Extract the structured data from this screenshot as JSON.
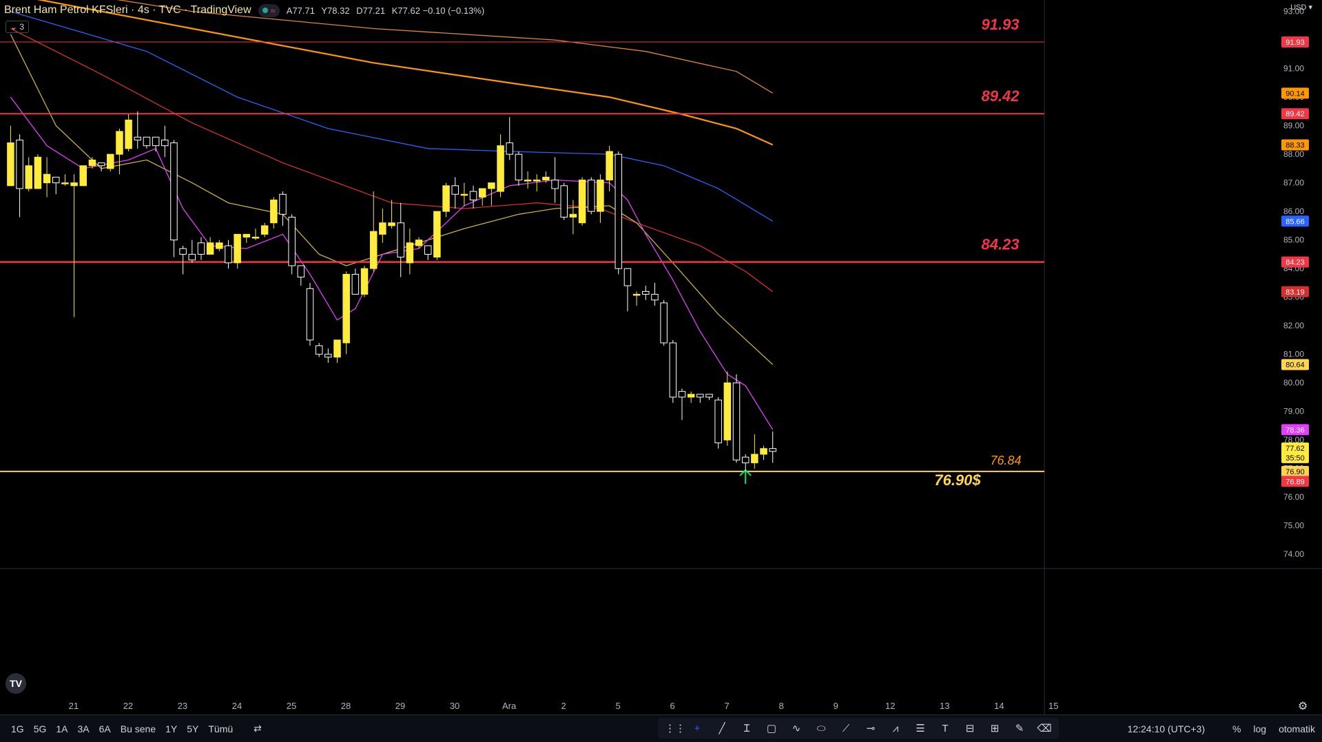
{
  "header": {
    "title": "Brent Ham Petrol KFSleri · 4s · TVC · TradingView",
    "open": "A77.71",
    "high": "Y78.32",
    "low": "D77.21",
    "close": "K77.62 −0.10 (−0.13%)",
    "collapse_label": "3",
    "currency": "USD"
  },
  "colors": {
    "candle_up": "#ffeb3b",
    "candle_down": "#ffffff",
    "level_red": "#f23645",
    "ema_orange": "#ff9800",
    "ema_orange_thin": "#e08a2a",
    "ema_blue": "#2962ff",
    "ema_red": "#d32f2f",
    "ema_yellow": "#c9b13d",
    "ema_magenta": "#e040fb",
    "support_yellow": "#ffd54f"
  },
  "chart_data": {
    "type": "candlestick",
    "y_range": [
      73.5,
      93.4
    ],
    "price_ticks": [
      "93.00",
      "92.00",
      "91.00",
      "90.00",
      "89.00",
      "88.00",
      "87.00",
      "86.00",
      "85.00",
      "84.00",
      "83.00",
      "82.00",
      "81.00",
      "80.00",
      "79.00",
      "78.00",
      "77.00",
      "76.00",
      "75.00",
      "74.00"
    ],
    "x_labels": [
      {
        "i": 3,
        "label": "21"
      },
      {
        "i": 9,
        "label": "22"
      },
      {
        "i": 15,
        "label": "23"
      },
      {
        "i": 21,
        "label": "24"
      },
      {
        "i": 27,
        "label": "25"
      },
      {
        "i": 33,
        "label": "28"
      },
      {
        "i": 39,
        "label": "29"
      },
      {
        "i": 45,
        "label": "30"
      },
      {
        "i": 51,
        "label": "Ara"
      },
      {
        "i": 57,
        "label": "2"
      },
      {
        "i": 63,
        "label": "5"
      },
      {
        "i": 69,
        "label": "6"
      },
      {
        "i": 75,
        "label": "7"
      },
      {
        "i": 81,
        "label": "8"
      },
      {
        "i": 87,
        "label": "9"
      },
      {
        "i": 93,
        "label": "12"
      },
      {
        "i": 99,
        "label": "13"
      },
      {
        "i": 105,
        "label": "14"
      },
      {
        "i": 111,
        "label": "15"
      }
    ],
    "candles": [
      [
        86.9,
        88.4,
        89.0,
        86.9
      ],
      [
        88.5,
        86.8,
        88.7,
        85.8
      ],
      [
        86.8,
        87.6,
        87.9,
        86.7
      ],
      [
        86.8,
        87.9,
        88.0,
        86.8
      ],
      [
        87.0,
        87.3,
        87.9,
        86.5
      ],
      [
        87.2,
        87.0,
        87.2,
        86.6
      ],
      [
        87.0,
        87.0,
        87.3,
        86.9
      ],
      [
        86.9,
        87.0,
        87.3,
        82.3
      ],
      [
        86.9,
        87.6,
        87.6,
        86.9
      ],
      [
        87.6,
        87.8,
        87.9,
        87.5
      ],
      [
        87.7,
        87.6,
        87.7,
        87.4
      ],
      [
        87.5,
        88.0,
        88.0,
        87.4
      ],
      [
        88.0,
        88.8,
        88.9,
        87.3
      ],
      [
        88.2,
        89.2,
        89.4,
        88.1
      ],
      [
        88.6,
        88.5,
        89.5,
        88.2
      ],
      [
        88.6,
        88.3,
        88.5,
        88.2
      ],
      [
        88.6,
        88.3,
        88.6,
        88.1
      ],
      [
        88.5,
        88.3,
        89.0,
        87.9
      ],
      [
        88.4,
        85.0,
        88.5,
        84.4
      ],
      [
        84.7,
        84.5,
        84.8,
        83.8
      ],
      [
        84.5,
        84.3,
        85.0,
        84.2
      ],
      [
        84.9,
        84.5,
        85.1,
        84.3
      ],
      [
        84.5,
        84.9,
        85.1,
        84.5
      ],
      [
        84.7,
        84.9,
        85.0,
        84.6
      ],
      [
        84.8,
        84.2,
        85.0,
        84.0
      ],
      [
        84.2,
        85.2,
        85.2,
        84.0
      ],
      [
        85.1,
        85.2,
        85.2,
        84.9
      ],
      [
        85.1,
        85.1,
        85.4,
        85.0
      ],
      [
        85.2,
        85.5,
        85.6,
        85.1
      ],
      [
        85.6,
        86.4,
        86.5,
        85.4
      ],
      [
        86.6,
        85.9,
        86.7,
        85.5
      ],
      [
        85.8,
        84.1,
        85.9,
        83.8
      ],
      [
        84.1,
        83.7,
        84.1,
        83.4
      ],
      [
        83.3,
        81.5,
        83.5,
        81.3
      ],
      [
        81.3,
        81.0,
        81.4,
        80.9
      ],
      [
        81.0,
        80.9,
        81.2,
        80.7
      ],
      [
        80.9,
        81.5,
        81.5,
        80.7
      ],
      [
        81.4,
        83.8,
        83.9,
        81.0
      ],
      [
        83.8,
        83.1,
        84.0,
        83.1
      ],
      [
        83.1,
        84.0,
        84.1,
        83.0
      ],
      [
        84.0,
        85.3,
        86.7,
        83.9
      ],
      [
        85.2,
        85.6,
        86.1,
        84.9
      ],
      [
        85.5,
        85.6,
        86.4,
        85.4
      ],
      [
        85.6,
        84.4,
        86.3,
        83.7
      ],
      [
        84.2,
        84.9,
        85.4,
        83.8
      ],
      [
        84.8,
        85.0,
        85.1,
        84.7
      ],
      [
        84.8,
        84.5,
        84.8,
        84.3
      ],
      [
        84.4,
        86.0,
        86.0,
        84.3
      ],
      [
        86.0,
        86.9,
        87.0,
        85.8
      ],
      [
        86.9,
        86.6,
        87.2,
        86.1
      ],
      [
        86.6,
        86.6,
        87.0,
        86.2
      ],
      [
        86.7,
        86.4,
        86.9,
        86.1
      ],
      [
        86.5,
        86.8,
        86.8,
        86.2
      ],
      [
        86.8,
        87.0,
        87.0,
        86.2
      ],
      [
        86.7,
        88.3,
        88.7,
        86.5
      ],
      [
        88.4,
        88.0,
        89.3,
        87.8
      ],
      [
        88.0,
        87.1,
        88.1,
        86.9
      ],
      [
        87.1,
        87.1,
        87.4,
        86.8
      ],
      [
        87.1,
        87.1,
        87.3,
        86.7
      ],
      [
        87.1,
        87.2,
        87.4,
        87.0
      ],
      [
        87.1,
        86.8,
        87.9,
        86.3
      ],
      [
        86.9,
        85.8,
        87.0,
        85.7
      ],
      [
        85.8,
        85.9,
        86.4,
        85.2
      ],
      [
        85.6,
        87.1,
        87.2,
        85.5
      ],
      [
        87.1,
        86.0,
        87.2,
        85.9
      ],
      [
        86.0,
        87.1,
        87.3,
        85.6
      ],
      [
        87.1,
        88.1,
        88.3,
        86.7
      ],
      [
        88.0,
        84.0,
        88.1,
        83.8
      ],
      [
        84.0,
        83.4,
        84.0,
        82.5
      ],
      [
        83.1,
        83.1,
        83.2,
        82.7
      ],
      [
        83.2,
        83.1,
        83.4,
        82.9
      ],
      [
        83.1,
        82.9,
        83.5,
        82.7
      ],
      [
        82.8,
        81.4,
        82.9,
        81.3
      ],
      [
        81.4,
        79.5,
        81.5,
        79.3
      ],
      [
        79.7,
        79.5,
        79.8,
        78.7
      ],
      [
        79.5,
        79.6,
        79.7,
        79.3
      ],
      [
        79.6,
        79.5,
        79.6,
        79.3
      ],
      [
        79.6,
        79.5,
        79.6,
        79.4
      ],
      [
        79.4,
        77.9,
        79.5,
        77.7
      ],
      [
        78.0,
        80.0,
        80.4,
        77.8
      ],
      [
        80.0,
        77.3,
        80.3,
        77.2
      ],
      [
        77.4,
        77.2,
        77.5,
        76.9
      ],
      [
        77.2,
        77.5,
        78.2,
        77.0
      ],
      [
        77.5,
        77.7,
        77.8,
        77.3
      ],
      [
        77.7,
        77.6,
        78.3,
        77.2
      ]
    ],
    "ema_series": [
      {
        "color_key": "ema_orange_thin",
        "pts": [
          [
            0,
            94.0
          ],
          [
            20,
            93.0
          ],
          [
            40,
            92.4
          ],
          [
            60,
            92.0
          ],
          [
            70,
            91.6
          ],
          [
            80,
            90.9
          ],
          [
            84,
            90.14
          ]
        ]
      },
      {
        "color_key": "ema_orange",
        "pts": [
          [
            0,
            93.6
          ],
          [
            20,
            92.4
          ],
          [
            40,
            91.2
          ],
          [
            55,
            90.5
          ],
          [
            66,
            90.0
          ],
          [
            74,
            89.4
          ],
          [
            80,
            88.9
          ],
          [
            84,
            88.33
          ]
        ]
      },
      {
        "color_key": "ema_blue",
        "pts": [
          [
            0,
            93.0
          ],
          [
            15,
            91.6
          ],
          [
            25,
            90.0
          ],
          [
            35,
            88.9
          ],
          [
            46,
            88.2
          ],
          [
            55,
            88.1
          ],
          [
            66,
            88.0
          ],
          [
            72,
            87.6
          ],
          [
            78,
            86.8
          ],
          [
            84,
            85.66
          ]
        ]
      },
      {
        "color_key": "ema_red",
        "pts": [
          [
            0,
            92.4
          ],
          [
            10,
            90.8
          ],
          [
            20,
            89.1
          ],
          [
            30,
            87.7
          ],
          [
            36,
            87.0
          ],
          [
            42,
            86.3
          ],
          [
            50,
            86.1
          ],
          [
            58,
            86.3
          ],
          [
            65,
            86.1
          ],
          [
            69,
            85.6
          ],
          [
            76,
            84.8
          ],
          [
            81,
            83.9
          ],
          [
            84,
            83.19
          ]
        ]
      },
      {
        "color_key": "ema_yellow",
        "pts": [
          [
            0,
            92.2
          ],
          [
            5,
            89.0
          ],
          [
            10,
            87.5
          ],
          [
            15,
            87.8
          ],
          [
            20,
            87.0
          ],
          [
            24,
            86.3
          ],
          [
            30,
            85.9
          ],
          [
            34,
            84.5
          ],
          [
            37,
            84.1
          ],
          [
            42,
            84.6
          ],
          [
            50,
            85.4
          ],
          [
            56,
            85.9
          ],
          [
            60,
            86.1
          ],
          [
            66,
            86.2
          ],
          [
            69,
            85.6
          ],
          [
            73,
            84.2
          ],
          [
            78,
            82.4
          ],
          [
            84,
            80.64
          ]
        ]
      },
      {
        "color_key": "ema_magenta",
        "pts": [
          [
            0,
            90.0
          ],
          [
            4,
            88.3
          ],
          [
            8,
            87.5
          ],
          [
            13,
            87.8
          ],
          [
            16,
            88.2
          ],
          [
            19,
            86.1
          ],
          [
            22,
            84.8
          ],
          [
            26,
            84.7
          ],
          [
            30,
            85.2
          ],
          [
            33,
            83.8
          ],
          [
            36,
            82.2
          ],
          [
            38,
            82.6
          ],
          [
            41,
            84.5
          ],
          [
            45,
            84.7
          ],
          [
            50,
            86.2
          ],
          [
            55,
            86.9
          ],
          [
            60,
            87.1
          ],
          [
            66,
            87.0
          ],
          [
            68,
            86.4
          ],
          [
            70,
            85.2
          ],
          [
            73,
            83.6
          ],
          [
            76,
            81.8
          ],
          [
            79,
            80.3
          ],
          [
            81,
            79.9
          ],
          [
            84,
            78.36
          ]
        ]
      }
    ],
    "levels": [
      {
        "price": 91.93,
        "label": "91.93",
        "color_key": "level_red",
        "width": 1
      },
      {
        "price": 89.42,
        "label": "89.42",
        "color_key": "level_red",
        "width": 2
      },
      {
        "price": 84.23,
        "label": "84.23",
        "color_key": "level_red",
        "width": 2.5
      }
    ],
    "support": {
      "price": 76.9,
      "label": "76.90$",
      "sub_label": "76.84",
      "arrow_index": 81
    },
    "axis_badges": [
      {
        "price": 91.93,
        "label": "91.93",
        "bg": "#f23645",
        "fg": "#ffffff"
      },
      {
        "price": 90.14,
        "label": "90.14",
        "bg": "#ff9800",
        "fg": "#000000"
      },
      {
        "price": 89.42,
        "label": "89.42",
        "bg": "#f23645",
        "fg": "#ffffff"
      },
      {
        "price": 88.33,
        "label": "88.33",
        "bg": "#ff9800",
        "fg": "#000000"
      },
      {
        "price": 85.66,
        "label": "85.66",
        "bg": "#2962ff",
        "fg": "#ffffff"
      },
      {
        "price": 84.23,
        "label": "84.23",
        "bg": "#f23645",
        "fg": "#ffffff"
      },
      {
        "price": 83.19,
        "label": "83.19",
        "bg": "#d32f2f",
        "fg": "#ffffff"
      },
      {
        "price": 80.64,
        "label": "80.64",
        "bg": "#ffd54f",
        "fg": "#000000"
      },
      {
        "price": 78.36,
        "label": "78.36",
        "bg": "#e040fb",
        "fg": "#ffffff"
      },
      {
        "price": 77.55,
        "label": "77.62\n35:50",
        "bg": "#ffeb3b",
        "fg": "#000000",
        "tall": true
      },
      {
        "price": 76.9,
        "label": "76.90",
        "bg": "#ffd54f",
        "fg": "#000000"
      },
      {
        "price": 76.55,
        "label": "76.89",
        "bg": "#f23645",
        "fg": "#ffffff"
      }
    ]
  },
  "bottom_bar": {
    "ranges": [
      "1G",
      "5G",
      "1A",
      "3A",
      "6A",
      "Bu sene",
      "1Y",
      "5Y",
      "Tümü"
    ],
    "clock": "12:24:10 (UTC+3)",
    "percent": "%",
    "log": "log",
    "auto": "otomatik"
  },
  "logo": "TV"
}
